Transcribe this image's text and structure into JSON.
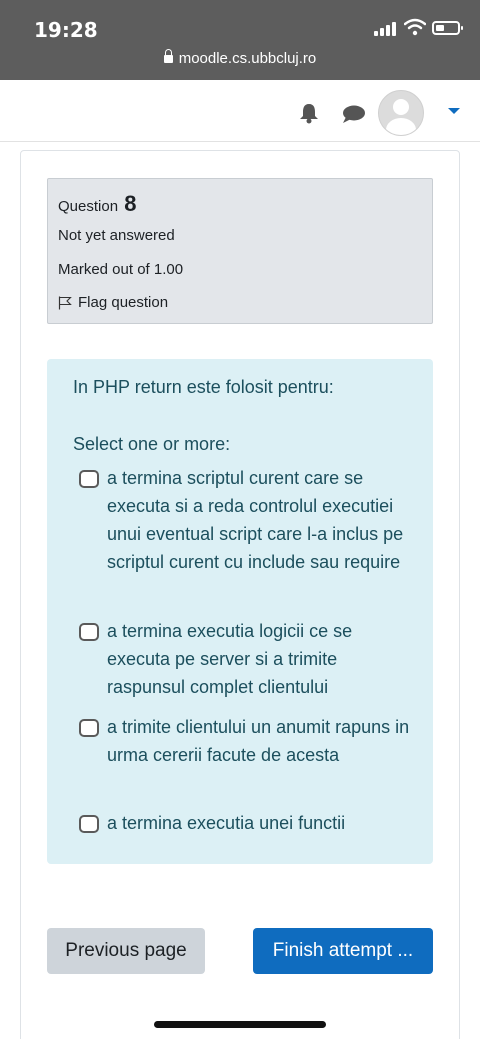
{
  "status_bar": {
    "time": "19:28"
  },
  "browser": {
    "url": "moodle.cs.ubbcluj.ro"
  },
  "navbar": {
    "icons": [
      "bell-icon",
      "chat-icon",
      "avatar",
      "caret-down-icon"
    ],
    "accent": "#0f6cbf"
  },
  "question_info": {
    "question_label": "Question",
    "question_number": "8",
    "state": "Not yet answered",
    "grade": "Marked out of 1.00",
    "flag_label": "Flag question"
  },
  "question": {
    "text": "In PHP return este folosit pentru:",
    "prompt": "Select one or more:",
    "options": [
      {
        "label": " a termina scriptul curent care se executa si a reda controlul executiei unui eventual script care l-a inclus pe scriptul curent cu include sau require",
        "checked": false
      },
      {
        "label": " a termina executia logicii ce se executa pe server si a trimite raspunsul complet clientului",
        "checked": false
      },
      {
        "label": " a trimite clientului un anumit rapuns in urma cererii facute de acesta",
        "checked": false
      },
      {
        "label": " a termina executia unei functii",
        "checked": false
      }
    ]
  },
  "navigation": {
    "previous_label": "Previous page",
    "finish_label": "Finish attempt ..."
  },
  "colors": {
    "info_bg": "#e3e6ea",
    "content_bg": "#dcf0f5",
    "content_text": "#1c4f5d",
    "primary": "#0f6cbf"
  }
}
